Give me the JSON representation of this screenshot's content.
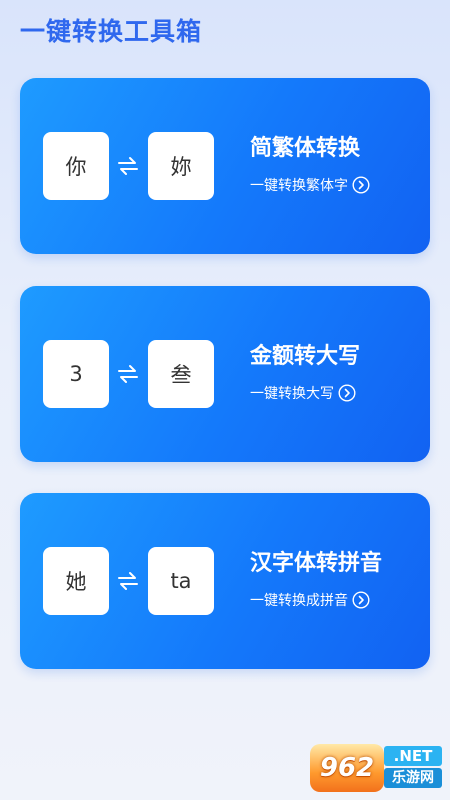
{
  "header": {
    "title": "一键转换工具箱"
  },
  "cards": [
    {
      "from": "你",
      "to": "妳",
      "title": "简繁体转换",
      "subtitle": "一键转换繁体字",
      "arrow_icon": "swap-arrows-icon",
      "chevron_icon": "chevron-right-circle-icon"
    },
    {
      "from": "3",
      "to": "叁",
      "title": "金额转大写",
      "subtitle": "一键转换大写",
      "arrow_icon": "swap-arrows-icon",
      "chevron_icon": "chevron-right-circle-icon"
    },
    {
      "from": "她",
      "to": "ta",
      "title": "汉字体转拼音",
      "subtitle": "一键转换成拼音",
      "arrow_icon": "swap-arrows-icon",
      "chevron_icon": "chevron-right-circle-icon"
    }
  ],
  "watermark": {
    "badge": "962",
    "net": ".NET",
    "cn": "乐游网"
  },
  "colors": {
    "accent": "#2f68ee",
    "card_start": "#1e9bff",
    "card_end": "#1262f2",
    "tile": "#ffffff"
  }
}
